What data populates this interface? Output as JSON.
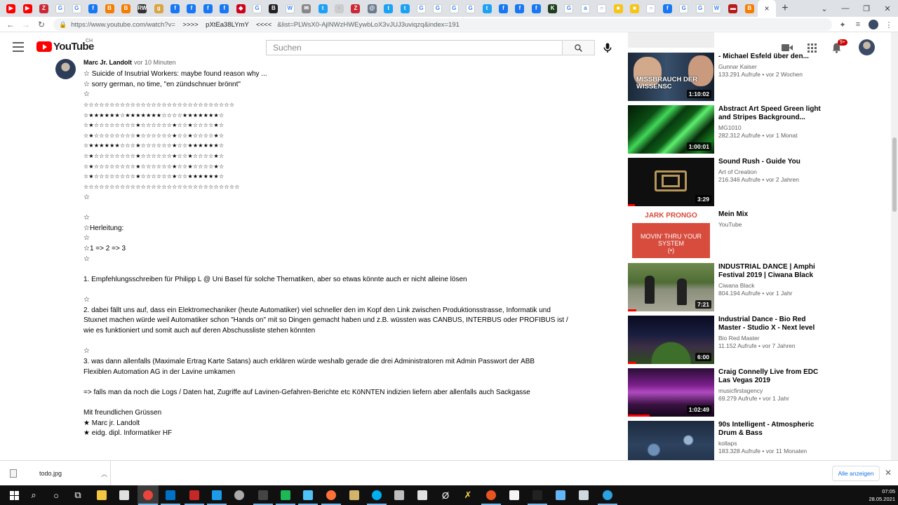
{
  "browser": {
    "tab_favicons": [
      {
        "icon": "youtube-icon",
        "color": "#ff0000",
        "glyph": "▶"
      },
      {
        "icon": "youtube-icon",
        "color": "#ff0000",
        "glyph": "▶"
      },
      {
        "icon": "zotero-icon",
        "color": "#cc2936",
        "glyph": "Z"
      },
      {
        "icon": "google-icon",
        "color": "#ffffff",
        "glyph": "G"
      },
      {
        "icon": "google-icon",
        "color": "#ffffff",
        "glyph": "G"
      },
      {
        "icon": "facebook-icon",
        "color": "#1877f2",
        "glyph": "f"
      },
      {
        "icon": "blogger-icon",
        "color": "#f57d00",
        "glyph": "B"
      },
      {
        "icon": "blogger-icon",
        "color": "#f57d00",
        "glyph": "B"
      },
      {
        "icon": "rw-icon",
        "color": "#333333",
        "glyph": "RW"
      },
      {
        "icon": "generic-icon",
        "color": "#d9a441",
        "glyph": "g"
      },
      {
        "icon": "facebook-icon",
        "color": "#1877f2",
        "glyph": "f"
      },
      {
        "icon": "facebook-icon",
        "color": "#1877f2",
        "glyph": "f"
      },
      {
        "icon": "facebook-icon",
        "color": "#1877f2",
        "glyph": "f"
      },
      {
        "icon": "facebook-icon",
        "color": "#1877f2",
        "glyph": "f"
      },
      {
        "icon": "flag-icon",
        "color": "#d0021b",
        "glyph": "◆"
      },
      {
        "icon": "google-icon",
        "color": "#ffffff",
        "glyph": "G"
      },
      {
        "icon": "bookmark-icon",
        "color": "#222222",
        "glyph": "B"
      },
      {
        "icon": "wikipedia-icon",
        "color": "#ffffff",
        "glyph": "W"
      },
      {
        "icon": "mail-icon",
        "color": "#888888",
        "glyph": "✉"
      },
      {
        "icon": "twitter-icon",
        "color": "#1da1f2",
        "glyph": "t"
      },
      {
        "icon": "generic-icon",
        "color": "#cccccc",
        "glyph": "·"
      },
      {
        "icon": "zotero-icon",
        "color": "#cc2936",
        "glyph": "Z"
      },
      {
        "icon": "generic-icon",
        "color": "#6b7b8c",
        "glyph": "@"
      },
      {
        "icon": "twitter-icon",
        "color": "#1da1f2",
        "glyph": "t"
      },
      {
        "icon": "twitter-icon",
        "color": "#1da1f2",
        "glyph": "t"
      },
      {
        "icon": "google-icon",
        "color": "#ffffff",
        "glyph": "G"
      },
      {
        "icon": "google-icon",
        "color": "#ffffff",
        "glyph": "G"
      },
      {
        "icon": "google-icon",
        "color": "#ffffff",
        "glyph": "G"
      },
      {
        "icon": "google-icon",
        "color": "#ffffff",
        "glyph": "G"
      },
      {
        "icon": "twitter-icon",
        "color": "#1da1f2",
        "glyph": "t"
      },
      {
        "icon": "facebook-icon",
        "color": "#1877f2",
        "glyph": "f"
      },
      {
        "icon": "facebook-icon",
        "color": "#1877f2",
        "glyph": "f"
      },
      {
        "icon": "facebook-icon",
        "color": "#1877f2",
        "glyph": "f"
      },
      {
        "icon": "generic-icon",
        "color": "#1e3d1e",
        "glyph": "K"
      },
      {
        "icon": "google-icon",
        "color": "#ffffff",
        "glyph": "G"
      },
      {
        "icon": "amazon-icon",
        "color": "#ffffff",
        "glyph": "a"
      },
      {
        "icon": "search-icon",
        "color": "#ffffff",
        "glyph": "○"
      },
      {
        "icon": "generic-icon",
        "color": "#f5c518",
        "glyph": "■"
      },
      {
        "icon": "generic-icon",
        "color": "#f5c518",
        "glyph": "■"
      },
      {
        "icon": "search-icon",
        "color": "#ffffff",
        "glyph": "○"
      },
      {
        "icon": "facebook-icon",
        "color": "#1877f2",
        "glyph": "f"
      },
      {
        "icon": "google-icon",
        "color": "#ffffff",
        "glyph": "G"
      },
      {
        "icon": "google-icon",
        "color": "#ffffff",
        "glyph": "G"
      },
      {
        "icon": "wikipedia-icon",
        "color": "#ffffff",
        "glyph": "W"
      },
      {
        "icon": "generic-icon",
        "color": "#b71c1c",
        "glyph": "▬"
      },
      {
        "icon": "blogger-icon",
        "color": "#f57d00",
        "glyph": "B"
      }
    ],
    "active_tab_close": "×",
    "new_tab": "+",
    "address": {
      "url_prefix": "https://www.youtube.com/watch?v=",
      "url_middle": "    >>>>    pXtEa38LYmY    <<<<   ",
      "url_suffix": "&list=PLWsX0-AjlNWzHWEywbLoX3vJUJ3uviqzq&index=191"
    }
  },
  "youtube": {
    "logo_text": "YouTube",
    "country": "CH",
    "search_placeholder": "Suchen",
    "notification_count": "9+"
  },
  "comment": {
    "author": "Marc Jr. Landolt",
    "time": "vor 10 Minuten",
    "lines": [
      "☆ Suicide of Insutrial Workers: maybe found reason why ...",
      "☆ sorry german, no time, \"en zündschnuer brönnt\"",
      "☆",
      "☆☆☆☆☆☆☆☆☆☆☆☆☆☆☆☆☆☆☆☆☆☆☆☆☆☆☆☆☆",
      "☆★★★★★★☆★★★★★★★☆☆☆☆★★★★★★★☆",
      "☆★☆☆☆☆☆☆☆☆★☆☆☆☆☆☆★☆☆★☆☆☆☆★☆",
      "☆★☆☆☆☆☆☆☆☆★☆☆☆☆☆☆★☆☆★☆☆☆☆★☆",
      "☆★★★★★★☆☆☆★☆☆☆☆☆☆★☆☆★★★★★★☆",
      "☆★☆☆☆☆☆☆☆☆★☆☆☆☆☆☆★☆☆★☆☆☆☆★☆",
      "☆★☆☆☆☆☆☆☆☆★☆☆☆☆☆☆★☆☆★☆☆☆☆★☆",
      "☆★☆☆☆☆☆☆☆☆★☆☆☆☆☆☆★☆☆★★★★★★☆",
      "☆☆☆☆☆☆☆☆☆☆☆☆☆☆☆☆☆☆☆☆☆☆☆☆☆☆☆☆☆☆",
      "☆",
      "",
      "☆",
      "☆Herleitung:",
      "☆",
      "☆1 => 2 => 3",
      "☆",
      "",
      "1. Empfehlungsschreiben für Philipp L @ Uni Basel für solche Thematiken, aber so etwas könnte auch er nicht alleine lösen",
      "",
      "☆",
      "2. dabei fällt uns auf, dass ein Elektromechaniker (heute Automatiker) viel schneller den im Kopf den Link zwischen Produktionsstrasse, Informatik und",
      "Stuxnet machen würde weil Automatiker schon \"Hands on\" mit so Dingen gemacht haben und z.B. wüssten was CANBUS, INTERBUS oder PROFIBUS ist /",
      "wie es funktioniert und somit auch auf deren Abschussliste stehen könnten",
      "",
      "☆",
      "3. was dann allenfalls (Maximale Ertrag Karte Satans) auch erklären würde weshalb gerade die drei Administratoren mit Admin Passwort der ABB",
      "Flexiblen Automation AG in der Lavine umkamen",
      "",
      "=> falls man da noch die Logs / Daten hat, Zugriffe auf Lavinen-Gefahren-Berichte etc KöNNTEN indizien liefern aber allenfalls auch Sackgasse",
      "",
      "Mit freundlichen Grüssen",
      "★ Marc jr. Landolt",
      "★ eidg. dipl. Informatiker HF"
    ]
  },
  "sidebar": {
    "videos": [
      {
        "title": "- Michael Esfeld über den...",
        "channel": "Gunnar Kaiser",
        "stats": "133.291 Aufrufe • vor 2 Wochen",
        "duration": "1:10:02",
        "thumb_text": "MISSBRAUCH DER WISSENSC",
        "progress": 0
      },
      {
        "title": "Abstract Art Speed Green light and Stripes Background...",
        "channel": "MG1010",
        "stats": "282.312 Aufrufe • vor 1 Monat",
        "duration": "1:00:01",
        "thumb_text": "",
        "progress": 0
      },
      {
        "title": "Sound Rush - Guide You",
        "channel": "Art of Creation",
        "stats": "216.346 Aufrufe • vor 2 Jahren",
        "duration": "3:29",
        "thumb_text": "",
        "progress": 0.08
      },
      {
        "title": "Mein Mix",
        "channel": "YouTube",
        "stats": "",
        "duration": "",
        "thumb_text": "JARK PRONGO",
        "thumb_sub": "MOVIN' THRU YOUR SYSTEM",
        "progress": 0
      },
      {
        "title": "INDUSTRIAL DANCE | Amphi Festival 2019 | Ciwana Black",
        "channel": "Ciwana Black",
        "stats": "804.194 Aufrufe • vor 1 Jahr",
        "duration": "7:21",
        "thumb_text": "",
        "progress": 0.1
      },
      {
        "title": "Industrial Dance - Bio Red Master - Studio X - Next level",
        "channel": "Bio Red Master",
        "stats": "11.152 Aufrufe • vor 7 Jahren",
        "duration": "6:00",
        "thumb_text": "",
        "progress": 0.1
      },
      {
        "title": "Craig Connelly Live from EDC Las Vegas 2019",
        "channel": "musicfirstagency",
        "stats": "69.279 Aufrufe • vor 1 Jahr",
        "duration": "1:02:49",
        "thumb_text": "",
        "progress": 0.25
      },
      {
        "title": "90s Intelligent - Atmospheric Drum & Bass",
        "channel": "kollaps",
        "stats": "183.328 Aufrufe • vor 11 Monaten",
        "duration": "",
        "thumb_text": "",
        "progress": 0
      }
    ]
  },
  "downloads": {
    "file_name": "todo.jpg",
    "show_all": "Alle anzeigen"
  },
  "taskbar": {
    "time": "07:05",
    "date": "28.05.2021"
  }
}
